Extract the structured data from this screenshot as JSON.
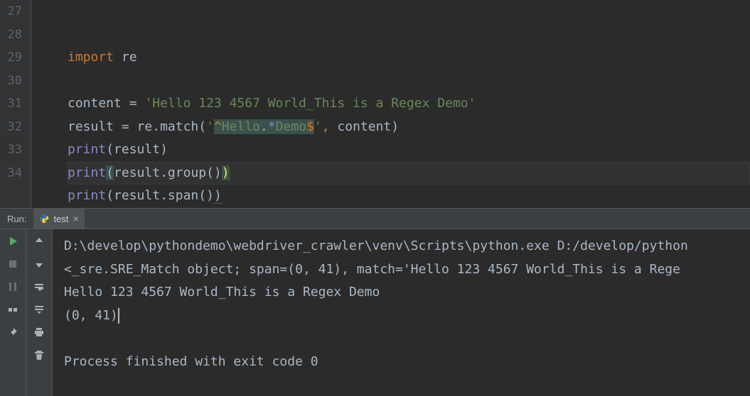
{
  "editor": {
    "gutter": [
      "27",
      "28",
      "29",
      "30",
      "31",
      "32",
      "33",
      "34"
    ],
    "lines": {
      "l28": {
        "kw": "import",
        "sp": " ",
        "mod": "re"
      },
      "l30": {
        "a": "content ",
        "eq": "= ",
        "str": "'Hello 123 4567 World_This is a Regex Demo'"
      },
      "l31": {
        "a": "result ",
        "eq": "= ",
        "b": "re",
        "dot": ".",
        "c": "match",
        "open": "(",
        "q1": "'",
        "r1": "^",
        "r2": "Hello",
        "r3": ".",
        "r4": "*",
        "r5": "Demo",
        "r6": "$",
        "q2": "'",
        "comma": ",",
        "sp": " ",
        "arg": "content",
        "close": ")"
      },
      "l32": {
        "fn": "print",
        "open": "(",
        "arg": "result",
        "close": ")"
      },
      "l33": {
        "fn": "print",
        "open": "(",
        "a": "result",
        "dot": ".",
        "m": "group",
        "p": "()",
        "close": ")"
      },
      "l34": {
        "fn": "print",
        "open": "(",
        "a": "result",
        "dot": ".",
        "m": "span",
        "p": "()",
        "close": ")"
      }
    }
  },
  "run": {
    "label": "Run:",
    "tab_name": "test",
    "output": {
      "l1": "D:\\develop\\pythondemo\\webdriver_crawler\\venv\\Scripts\\python.exe D:/develop/python",
      "l2": "<_sre.SRE_Match object; span=(0, 41), match='Hello 123 4567 World_This is a Rege",
      "l3": "Hello 123 4567 World_This is a Regex Demo",
      "l4": "(0, 41)",
      "l5": "",
      "l6": "Process finished with exit code 0"
    }
  }
}
